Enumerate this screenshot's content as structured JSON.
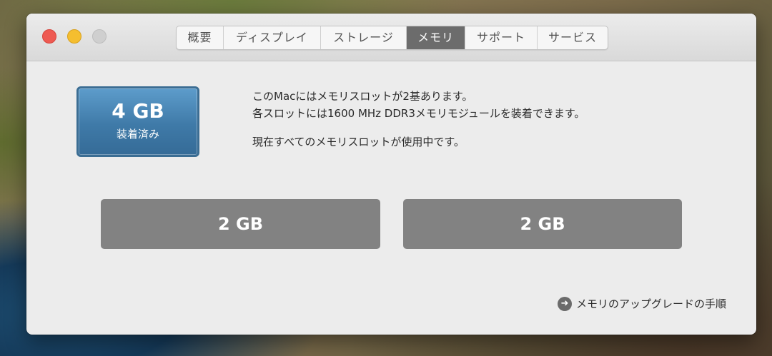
{
  "tabs": [
    {
      "label": "概要",
      "active": false
    },
    {
      "label": "ディスプレイ",
      "active": false
    },
    {
      "label": "ストレージ",
      "active": false
    },
    {
      "label": "メモリ",
      "active": true
    },
    {
      "label": "サポート",
      "active": false
    },
    {
      "label": "サービス",
      "active": false
    }
  ],
  "memory": {
    "installed_size": "4 GB",
    "installed_label": "装着済み",
    "info_line1": "このMacにはメモリスロットが2基あります。",
    "info_line2": "各スロットには1600 MHz DDR3メモリモジュールを装着できます。",
    "info_line3": "現在すべてのメモリスロットが使用中です。",
    "slots": [
      "2 GB",
      "2 GB"
    ],
    "upgrade_link": "メモリのアップグレードの手順"
  },
  "colors": {
    "active_tab": "#6c6c6c",
    "chip_blue": "#3f7aa8",
    "slot_gray": "#828282",
    "close": "#ee5a52",
    "minimize": "#f5be2f"
  }
}
